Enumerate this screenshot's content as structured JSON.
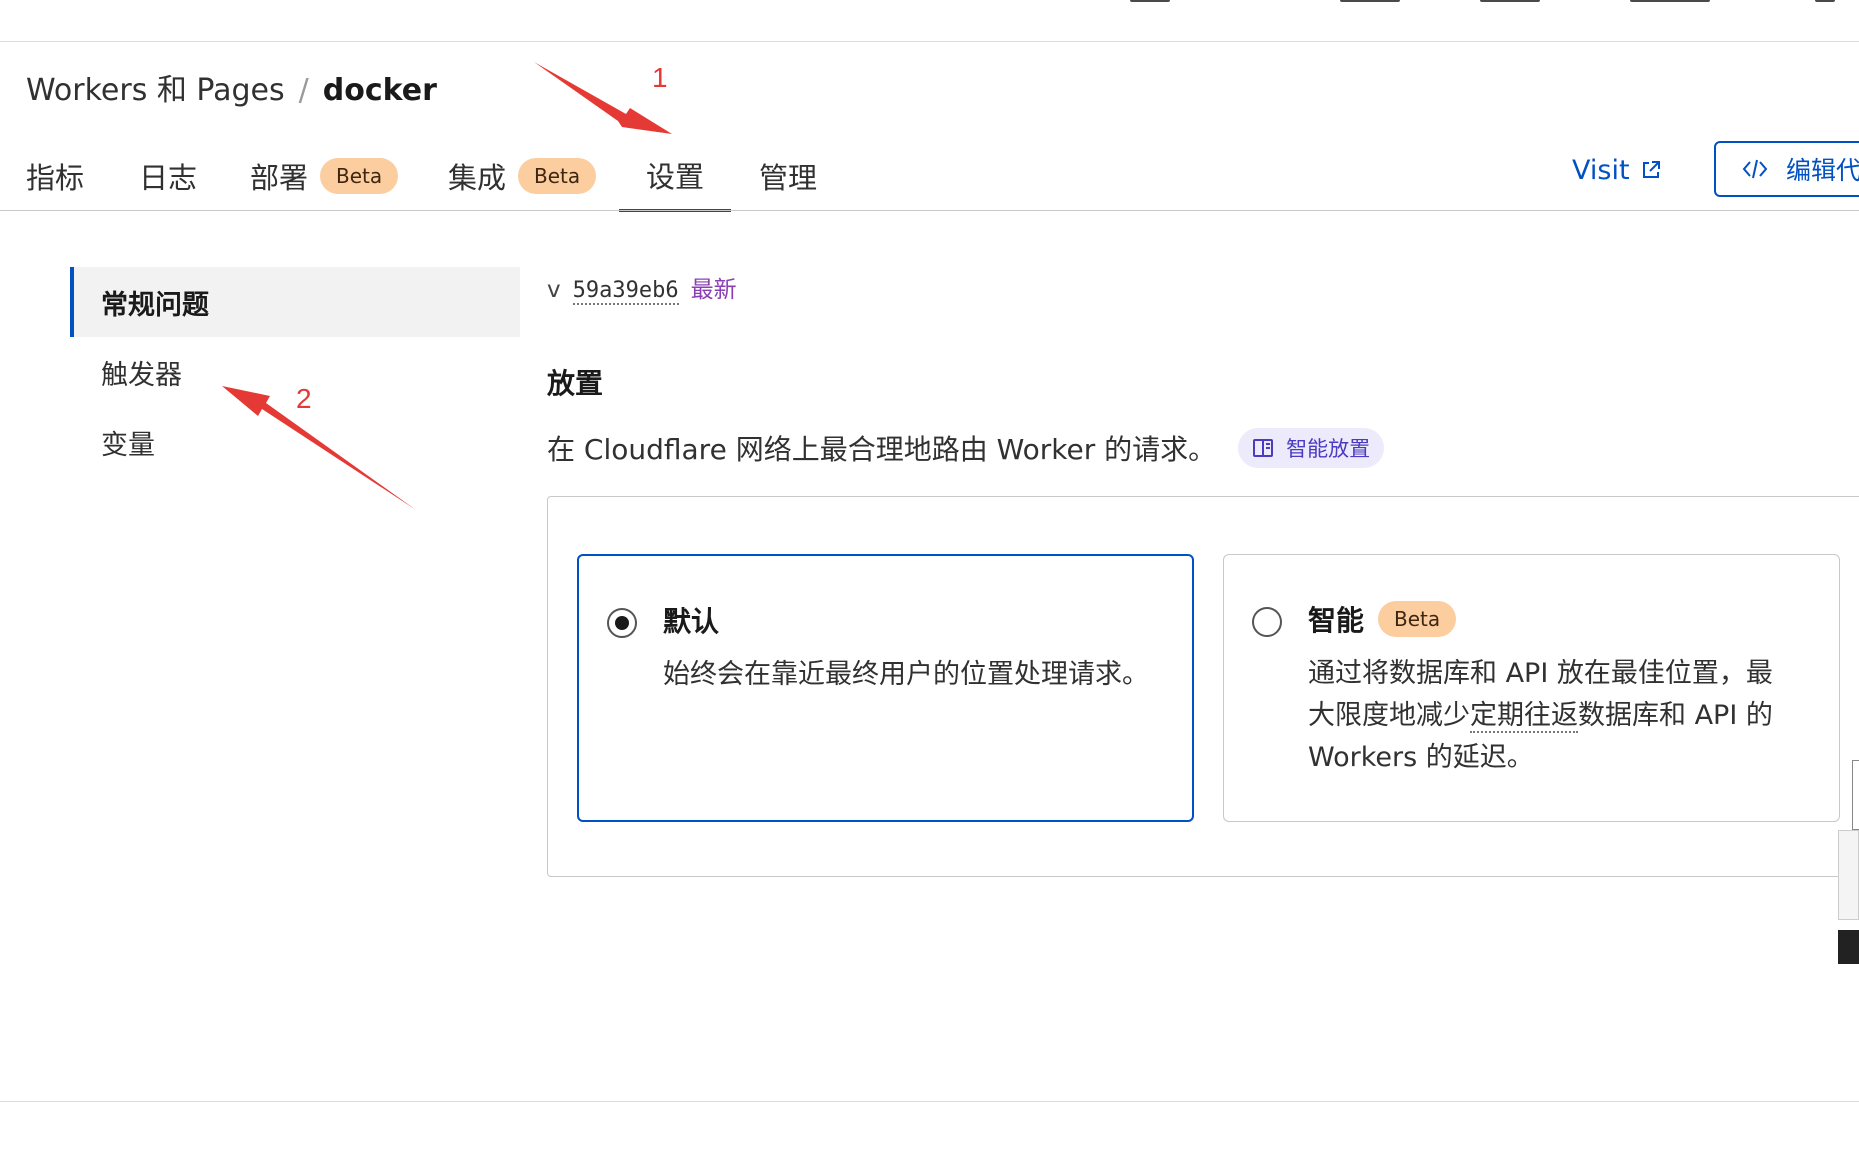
{
  "breadcrumb": {
    "root": "Workers 和 Pages",
    "separator": "/",
    "current": "docker"
  },
  "tabs": [
    {
      "label": "指标"
    },
    {
      "label": "日志"
    },
    {
      "label": "部署",
      "badge": "Beta"
    },
    {
      "label": "集成",
      "badge": "Beta"
    },
    {
      "label": "设置",
      "active": true
    },
    {
      "label": "管理"
    }
  ],
  "header_actions": {
    "visit_label": "Visit",
    "edit_label": "编辑代"
  },
  "sidebar": {
    "items": [
      {
        "label": "常规问题",
        "active": true
      },
      {
        "label": "触发器"
      },
      {
        "label": "变量"
      }
    ]
  },
  "version": {
    "prefix": "v",
    "hash": "59a39eb6",
    "status": "最新"
  },
  "placement": {
    "title": "放置",
    "description": "在 Cloudflare 网络上最合理地路由 Worker 的请求。",
    "doc_link": "智能放置",
    "options": [
      {
        "title": "默认",
        "selected": true,
        "description": "始终会在靠近最终用户的位置处理请求。"
      },
      {
        "title": "智能",
        "badge": "Beta",
        "selected": false,
        "description_parts": [
          "通过将数据库和 API 放在最佳位置，最大限度地减少",
          "定期往返",
          "数据库和 API 的 Workers 的延迟。"
        ]
      }
    ]
  },
  "annotations": {
    "arrow_1": "1",
    "arrow_2": "2"
  },
  "colors": {
    "accent": "#0051c3",
    "badge_bg": "#fbcd9f",
    "latest": "#8a3fb4",
    "annotation": "#e53935",
    "doc_pill_bg": "#eceafb"
  }
}
